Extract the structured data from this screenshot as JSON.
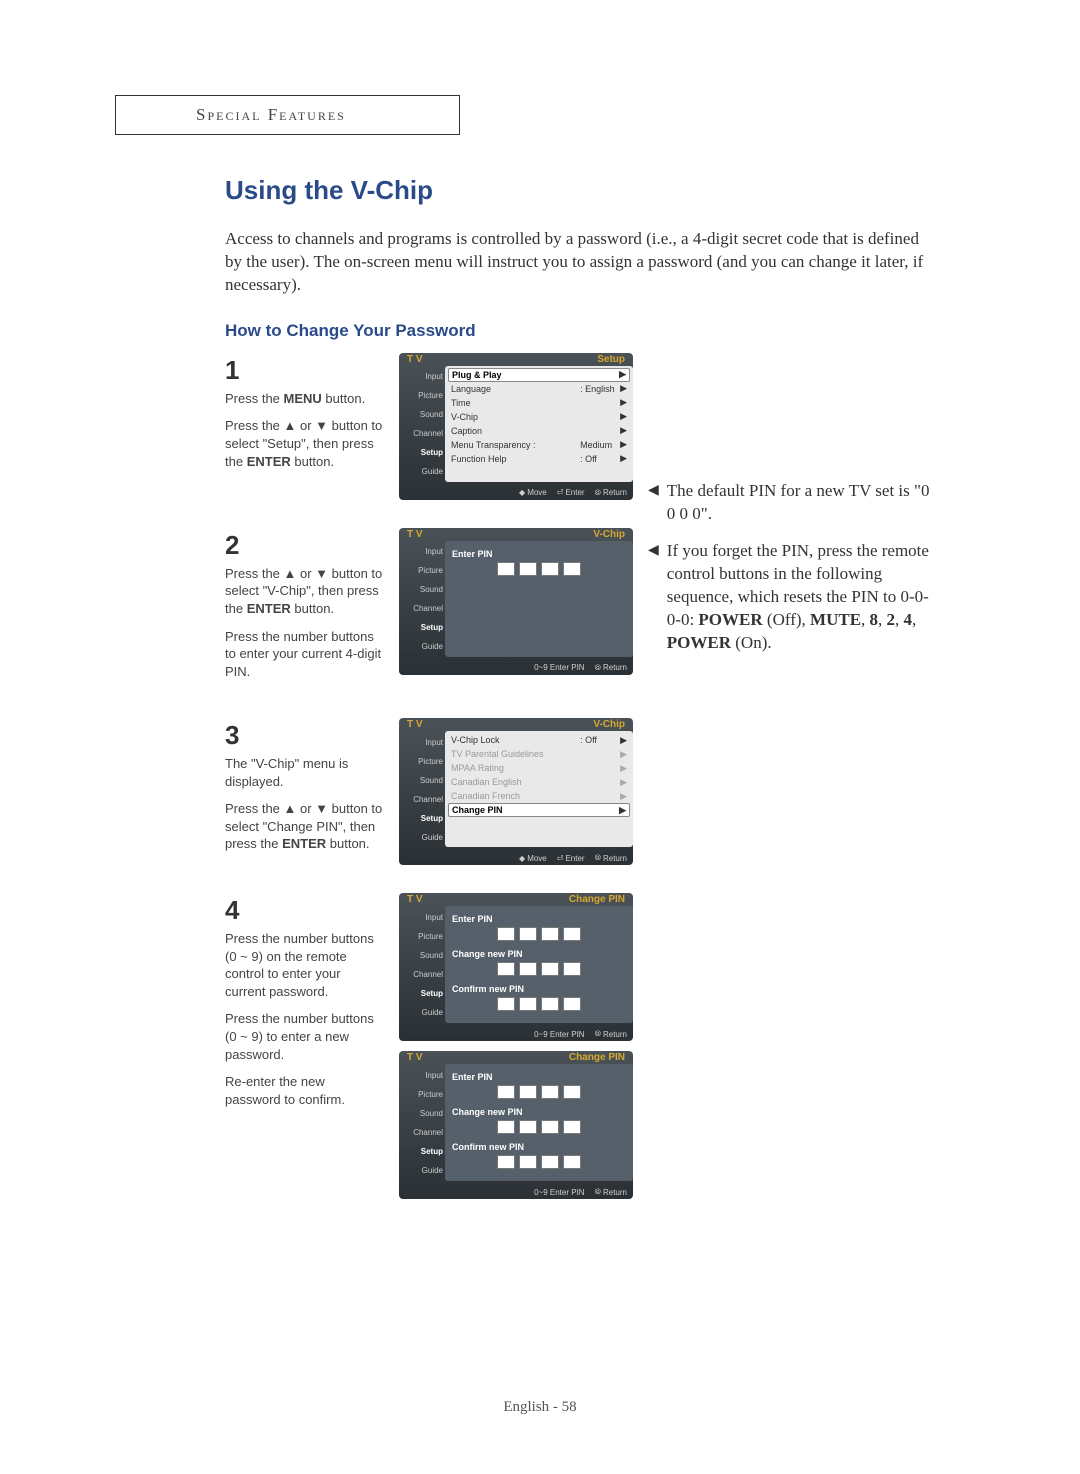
{
  "header": "Special Features",
  "title": "Using the V-Chip",
  "intro": "Access to channels and programs is controlled by a password (i.e., a 4-digit secret code that is defined by the user). The on-screen menu will instruct you to assign a password (and you can change it later, if necessary).",
  "subtitle": "How to Change Your Password",
  "steps": {
    "s1": {
      "num": "1",
      "p1": "Press the MENU button.",
      "p2": "Press the ▲ or ▼ button to select \"Setup\", then press the ENTER button."
    },
    "s2": {
      "num": "2",
      "p1": "Press the ▲ or ▼ button to select \"V-Chip\", then press the ENTER button.",
      "p2": "Press the number buttons to enter your current 4-digit PIN."
    },
    "s3": {
      "num": "3",
      "p1": "The \"V-Chip\" menu is displayed.",
      "p2": "Press the ▲ or ▼ button to select \"Change PIN\", then press the ENTER button."
    },
    "s4": {
      "num": "4",
      "p1": "Press the number buttons (0 ~ 9) on the remote control to enter your current password.",
      "p2": "Press the number buttons (0 ~ 9) to enter a new password.",
      "p3": "Re-enter the new password to confirm."
    }
  },
  "notes": {
    "n1": "The default PIN for a new TV set is \"0 0 0 0\".",
    "n2a": "If you forget the PIN, press the remote control buttons in the following sequence, which resets the PIN to 0-0-0-0: ",
    "n2b": "POWER (Off), MUTE, 8, 2, 4, POWER (On)."
  },
  "sideTabs": [
    "Input",
    "Picture",
    "Sound",
    "Channel",
    "Setup",
    "Guide"
  ],
  "osd1": {
    "tv": "T V",
    "title": "Setup",
    "lines": [
      {
        "l": "Plug & Play",
        "v": "",
        "hl": true
      },
      {
        "l": "Language",
        "v": ": English"
      },
      {
        "l": "Time",
        "v": ""
      },
      {
        "l": "V-Chip",
        "v": ""
      },
      {
        "l": "Caption",
        "v": ""
      },
      {
        "l": "Menu Transparency :",
        "v": "Medium"
      },
      {
        "l": "Function Help",
        "v": ": Off"
      }
    ],
    "foot": [
      "Move",
      "Enter",
      "Return"
    ]
  },
  "osd2": {
    "tv": "T V",
    "title": "V-Chip",
    "label": "Enter PIN",
    "foot": [
      "0~9 Enter PIN",
      "Return"
    ]
  },
  "osd3": {
    "tv": "T V",
    "title": "V-Chip",
    "lines": [
      {
        "l": "V-Chip Lock",
        "v": ": Off",
        "dim": false
      },
      {
        "l": "TV Parental Guidelines",
        "v": "",
        "dim": true
      },
      {
        "l": "MPAA Rating",
        "v": "",
        "dim": true
      },
      {
        "l": "Canadian English",
        "v": "",
        "dim": true
      },
      {
        "l": "Canadian French",
        "v": "",
        "dim": true
      },
      {
        "l": "Change PIN",
        "v": "",
        "hl": true
      }
    ],
    "foot": [
      "Move",
      "Enter",
      "Return"
    ]
  },
  "osd4a": {
    "tv": "T V",
    "title": "Change PIN",
    "l1": "Enter PIN",
    "l2": "Change new PIN",
    "l3": "Confirm new PIN",
    "stars": [
      "★",
      "★",
      "★",
      ""
    ],
    "foot": [
      "0~9 Enter PIN",
      "Return"
    ]
  },
  "osd4b": {
    "tv": "T V",
    "title": "Change PIN",
    "l1": "Enter PIN",
    "l2": "Change new PIN",
    "l3": "Confirm new PIN",
    "stars": [
      "★",
      "★",
      "★",
      "★"
    ],
    "foot": [
      "0~9 Enter PIN",
      "Return"
    ]
  },
  "footer": "English - 58"
}
